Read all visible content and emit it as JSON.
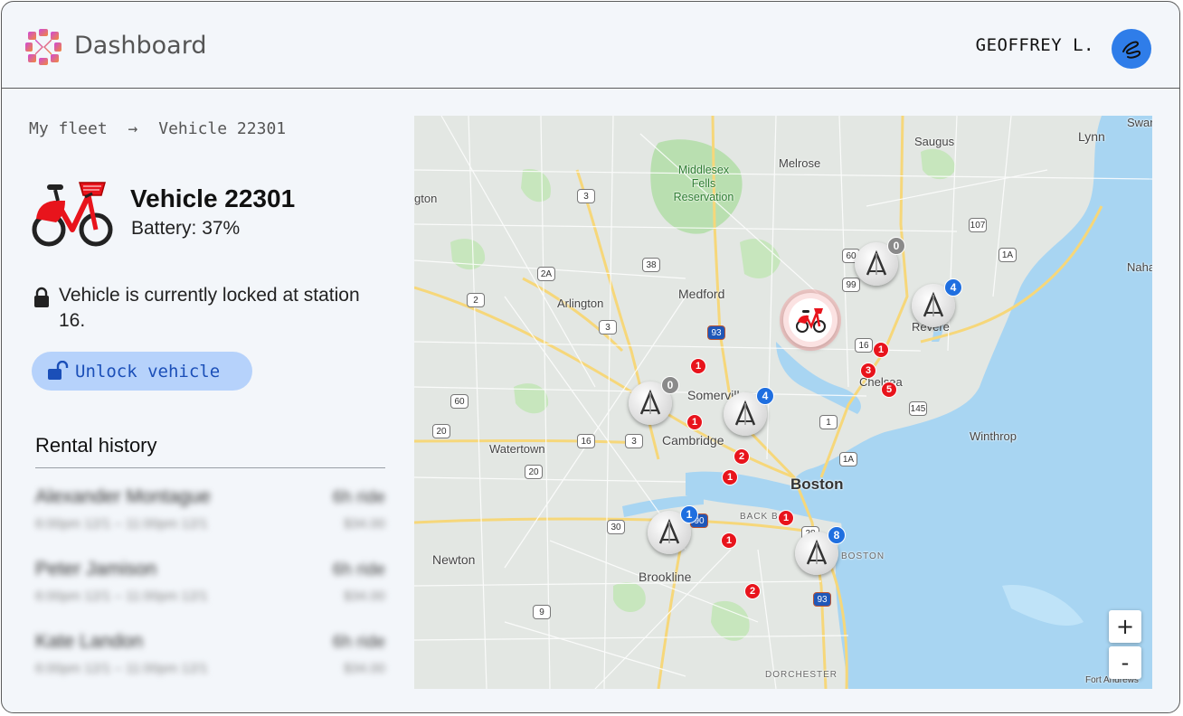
{
  "header": {
    "app_title": "Dashboard",
    "user_name": "GEOFFREY L."
  },
  "breadcrumb": {
    "parent": "My fleet",
    "separator": "→",
    "current": "Vehicle 22301"
  },
  "vehicle": {
    "title": "Vehicle 22301",
    "battery_label": "Battery: 37%",
    "status_text": "Vehicle is currently locked at station 16.",
    "unlock_label": "Unlock vehicle"
  },
  "rental_history": {
    "title": "Rental history",
    "items": [
      {
        "name": "Alexander Montague",
        "time": "6:00pm 12/1 – 11:00pm 12/1",
        "duration": "6h ride",
        "price": "$34.00"
      },
      {
        "name": "Peter Jamison",
        "time": "6:00pm 12/1 – 11:00pm 12/1",
        "duration": "6h ride",
        "price": "$34.00"
      },
      {
        "name": "Kate Landon",
        "time": "6:00pm 12/1 – 11:00pm 12/1",
        "duration": "6h ride",
        "price": "$34.00"
      }
    ]
  },
  "map": {
    "places": {
      "saugus": "Saugus",
      "lynn": "Lynn",
      "swampscott": "Swan",
      "melrose": "Melrose",
      "middlesex": "Middlesex Fells Reservation",
      "winchester": "gton",
      "nahant": "Nahan",
      "arlington": "Arlington",
      "medford": "Medford",
      "revere": "Revere",
      "chelsea": "Chelsea",
      "somerville": "Somerville",
      "cambridge": "Cambridge",
      "watertown": "Watertown",
      "boston": "Boston",
      "winthrop": "Winthrop",
      "back_bay": "BACK BAY",
      "south_boston": "BOSTON",
      "newton": "Newton",
      "brookline": "Brookline",
      "dorchester": "DORCHESTER",
      "fort_andrews": "Fort Andrews"
    },
    "route_shields": [
      "3",
      "38",
      "2A",
      "2",
      "60",
      "3",
      "93",
      "60",
      "99",
      "107",
      "1A",
      "16",
      "1",
      "145",
      "16",
      "20",
      "3",
      "20",
      "1A",
      "90",
      "30",
      "9",
      "93",
      "28"
    ],
    "stations": [
      {
        "count": "0",
        "badge_color": "grey"
      },
      {
        "count": "4",
        "badge_color": "blue"
      },
      {
        "count": "0",
        "badge_color": "grey"
      },
      {
        "count": "4",
        "badge_color": "blue"
      },
      {
        "count": "1",
        "badge_color": "blue"
      },
      {
        "count": "8",
        "badge_color": "blue"
      }
    ],
    "rentals": [
      "1",
      "1",
      "3",
      "5",
      "1",
      "2",
      "1",
      "1",
      "1",
      "2"
    ],
    "zoom_in": "+",
    "zoom_out": "-"
  },
  "colors": {
    "accent": "#2f7de9",
    "unlock_bg": "#b6d2fb",
    "rental_red": "#e8141c",
    "water": "#a8d5f2",
    "park": "#b9dfb0"
  }
}
